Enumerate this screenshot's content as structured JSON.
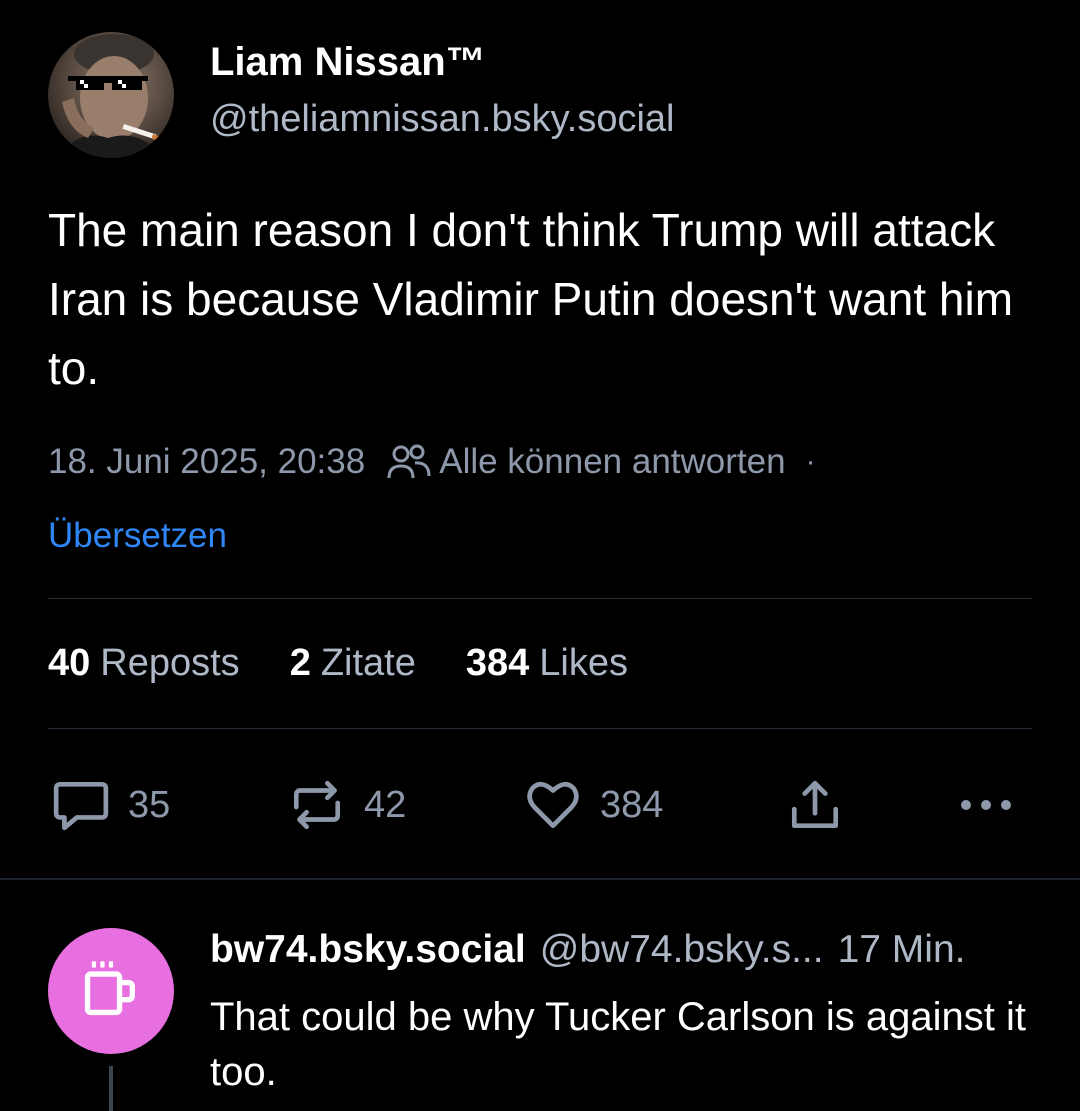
{
  "post": {
    "author": {
      "display_name": "Liam Nissan™",
      "handle": "@theliamnissan.bsky.social",
      "avatar": "profile-photo"
    },
    "text": "The main reason I don't think Trump will attack Iran is because Vladimir Putin doesn't want him to.",
    "timestamp": "18. Juni 2025, 20:38",
    "reply_setting_icon": "people-icon",
    "reply_setting": "Alle können antworten",
    "separator": "·",
    "translate_label": "Übersetzen",
    "stats": {
      "reposts_count": "40",
      "reposts_label": "Reposts",
      "quotes_count": "2",
      "quotes_label": "Zitate",
      "likes_count": "384",
      "likes_label": "Likes"
    },
    "actions": {
      "reply_icon": "comment-icon",
      "reply_count": "35",
      "repost_icon": "repost-icon",
      "repost_count": "42",
      "like_icon": "heart-icon",
      "like_count": "384",
      "share_icon": "share-icon",
      "more_icon": "more-icon"
    }
  },
  "reply": {
    "display_name": "bw74.bsky.social",
    "handle": "@bw74.bsky.s...",
    "time_ago": "17 Min.",
    "text": "That could be why Tucker Carlson is against it too.",
    "avatar_icon": "coffee-cup-icon"
  },
  "colors": {
    "background": "#000000",
    "text_primary": "#ffffff",
    "text_secondary": "#aeb8c6",
    "text_muted": "#8d99aa",
    "link": "#2f86f6",
    "divider": "#26303b",
    "reply_avatar_bg": "#e86fe0"
  }
}
